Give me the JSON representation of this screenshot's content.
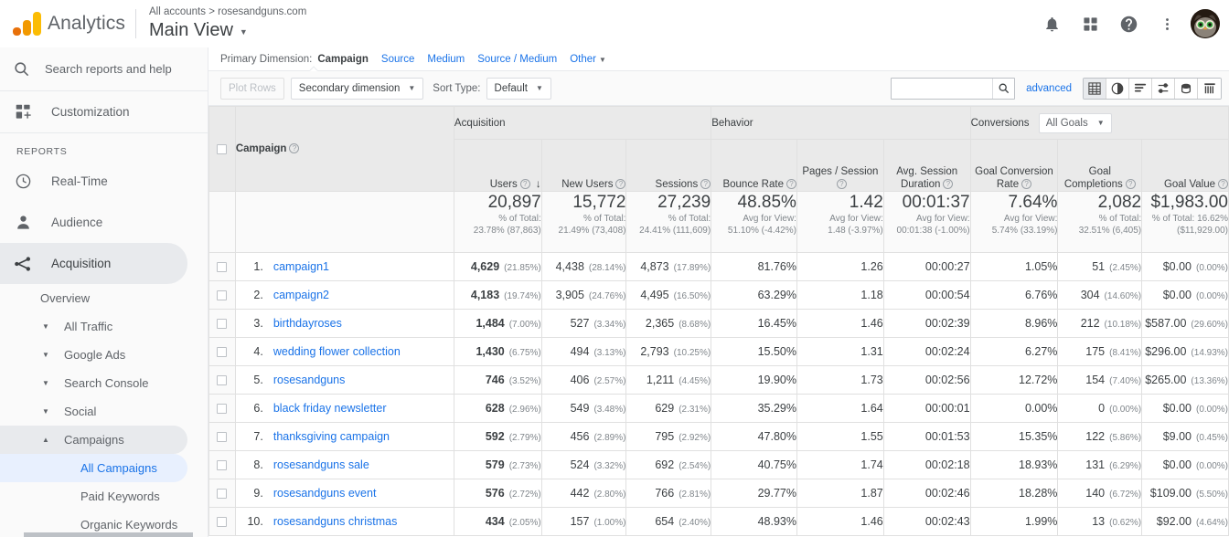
{
  "header": {
    "brand": "Analytics",
    "breadcrumb": "All accounts > rosesandguns.com",
    "view_name": "Main View",
    "view_caret": "▼",
    "icons": {
      "notifications": "bell-icon",
      "apps": "apps-grid-icon",
      "help": "help-circle-icon",
      "more": "more-vertical-icon",
      "account": "avatar"
    }
  },
  "sidebar": {
    "search_placeholder": "Search reports and help",
    "customization": "Customization",
    "reports_label": "REPORTS",
    "items": [
      {
        "label": "Real-Time",
        "icon": "clock-icon"
      },
      {
        "label": "Audience",
        "icon": "person-icon"
      },
      {
        "label": "Acquisition",
        "icon": "acquisition-icon",
        "active": true
      }
    ],
    "acquisition_sub": [
      {
        "label": "Overview",
        "caret": ""
      },
      {
        "label": "All Traffic",
        "caret": "▼"
      },
      {
        "label": "Google Ads",
        "caret": "▼"
      },
      {
        "label": "Search Console",
        "caret": "▼"
      },
      {
        "label": "Social",
        "caret": "▼"
      },
      {
        "label": "Campaigns",
        "caret": "▲",
        "open": true
      }
    ],
    "campaigns_sub": [
      {
        "label": "All Campaigns",
        "selected": true
      },
      {
        "label": "Paid Keywords"
      },
      {
        "label": "Organic Keywords"
      }
    ]
  },
  "dimension_row": {
    "label": "Primary Dimension:",
    "selected": "Campaign",
    "links": [
      "Source",
      "Medium",
      "Source / Medium"
    ],
    "other": "Other",
    "other_caret": "▼"
  },
  "toolbar": {
    "plot_rows": "Plot Rows",
    "secondary_dimension": "Secondary dimension",
    "sort_type_label": "Sort Type:",
    "sort_type_value": "Default",
    "dropdown_caret": "▼",
    "search_value": "",
    "search_placeholder": "",
    "advanced": "advanced",
    "view_icons": [
      {
        "name": "table-view-icon",
        "active": true
      },
      {
        "name": "pie-chart-view-icon",
        "active": false
      },
      {
        "name": "performance-view-icon",
        "active": false
      },
      {
        "name": "comparison-view-icon",
        "active": false
      },
      {
        "name": "pivot-view-icon",
        "active": false
      },
      {
        "name": "bar-view-icon",
        "active": false
      }
    ]
  },
  "table": {
    "groups": [
      {
        "label": "Acquisition",
        "span": 3
      },
      {
        "label": "Behavior",
        "span": 3
      },
      {
        "label": "Conversions",
        "span": 3,
        "goal_select": "All Goals",
        "goal_caret": "▼"
      }
    ],
    "dimension_header": "Campaign",
    "columns": [
      {
        "label": "Users",
        "sorted": true,
        "sort_icon": "↓"
      },
      {
        "label": "New Users"
      },
      {
        "label": "Sessions"
      },
      {
        "label": "Bounce Rate"
      },
      {
        "label": "Pages / Session"
      },
      {
        "label": "Avg. Session Duration"
      },
      {
        "label": "Goal Conversion Rate"
      },
      {
        "label": "Goal Completions"
      },
      {
        "label": "Goal Value"
      }
    ],
    "totals": [
      {
        "value": "20,897",
        "sub1": "% of Total:",
        "sub2": "23.78% (87,863)"
      },
      {
        "value": "15,772",
        "sub1": "% of Total:",
        "sub2": "21.49% (73,408)"
      },
      {
        "value": "27,239",
        "sub1": "% of Total:",
        "sub2": "24.41% (111,609)"
      },
      {
        "value": "48.85%",
        "sub1": "Avg for View:",
        "sub2": "51.10% (-4.42%)"
      },
      {
        "value": "1.42",
        "sub1": "Avg for View:",
        "sub2": "1.48 (-3.97%)"
      },
      {
        "value": "00:01:37",
        "sub1": "Avg for View:",
        "sub2": "00:01:38 (-1.00%)"
      },
      {
        "value": "7.64%",
        "sub1": "Avg for View:",
        "sub2": "5.74% (33.19%)"
      },
      {
        "value": "2,082",
        "sub1": "% of Total:",
        "sub2": "32.51% (6,405)"
      },
      {
        "value": "$1,983.00",
        "sub1": "% of Total: 16.62%",
        "sub2": "($11,929.00)"
      }
    ],
    "rows": [
      {
        "n": "1.",
        "name": "campaign1",
        "users": "4,629",
        "users_pct": "(21.85%)",
        "new_users": "4,438",
        "new_users_pct": "(28.14%)",
        "sessions": "4,873",
        "sessions_pct": "(17.89%)",
        "bounce": "81.76%",
        "pages": "1.26",
        "duration": "00:00:27",
        "gcr": "1.05%",
        "gc": "51",
        "gc_pct": "(2.45%)",
        "gv": "$0.00",
        "gv_pct": "(0.00%)"
      },
      {
        "n": "2.",
        "name": "campaign2",
        "users": "4,183",
        "users_pct": "(19.74%)",
        "new_users": "3,905",
        "new_users_pct": "(24.76%)",
        "sessions": "4,495",
        "sessions_pct": "(16.50%)",
        "bounce": "63.29%",
        "pages": "1.18",
        "duration": "00:00:54",
        "gcr": "6.76%",
        "gc": "304",
        "gc_pct": "(14.60%)",
        "gv": "$0.00",
        "gv_pct": "(0.00%)"
      },
      {
        "n": "3.",
        "name": "birthdayroses",
        "users": "1,484",
        "users_pct": "(7.00%)",
        "new_users": "527",
        "new_users_pct": "(3.34%)",
        "sessions": "2,365",
        "sessions_pct": "(8.68%)",
        "bounce": "16.45%",
        "pages": "1.46",
        "duration": "00:02:39",
        "gcr": "8.96%",
        "gc": "212",
        "gc_pct": "(10.18%)",
        "gv": "$587.00",
        "gv_pct": "(29.60%)"
      },
      {
        "n": "4.",
        "name": "wedding flower collection",
        "users": "1,430",
        "users_pct": "(6.75%)",
        "new_users": "494",
        "new_users_pct": "(3.13%)",
        "sessions": "2,793",
        "sessions_pct": "(10.25%)",
        "bounce": "15.50%",
        "pages": "1.31",
        "duration": "00:02:24",
        "gcr": "6.27%",
        "gc": "175",
        "gc_pct": "(8.41%)",
        "gv": "$296.00",
        "gv_pct": "(14.93%)"
      },
      {
        "n": "5.",
        "name": "rosesandguns",
        "users": "746",
        "users_pct": "(3.52%)",
        "new_users": "406",
        "new_users_pct": "(2.57%)",
        "sessions": "1,211",
        "sessions_pct": "(4.45%)",
        "bounce": "19.90%",
        "pages": "1.73",
        "duration": "00:02:56",
        "gcr": "12.72%",
        "gc": "154",
        "gc_pct": "(7.40%)",
        "gv": "$265.00",
        "gv_pct": "(13.36%)"
      },
      {
        "n": "6.",
        "name": "black friday newsletter",
        "users": "628",
        "users_pct": "(2.96%)",
        "new_users": "549",
        "new_users_pct": "(3.48%)",
        "sessions": "629",
        "sessions_pct": "(2.31%)",
        "bounce": "35.29%",
        "pages": "1.64",
        "duration": "00:00:01",
        "gcr": "0.00%",
        "gc": "0",
        "gc_pct": "(0.00%)",
        "gv": "$0.00",
        "gv_pct": "(0.00%)"
      },
      {
        "n": "7.",
        "name": "thanksgiving campaign",
        "users": "592",
        "users_pct": "(2.79%)",
        "new_users": "456",
        "new_users_pct": "(2.89%)",
        "sessions": "795",
        "sessions_pct": "(2.92%)",
        "bounce": "47.80%",
        "pages": "1.55",
        "duration": "00:01:53",
        "gcr": "15.35%",
        "gc": "122",
        "gc_pct": "(5.86%)",
        "gv": "$9.00",
        "gv_pct": "(0.45%)"
      },
      {
        "n": "8.",
        "name": "rosesandguns sale",
        "users": "579",
        "users_pct": "(2.73%)",
        "new_users": "524",
        "new_users_pct": "(3.32%)",
        "sessions": "692",
        "sessions_pct": "(2.54%)",
        "bounce": "40.75%",
        "pages": "1.74",
        "duration": "00:02:18",
        "gcr": "18.93%",
        "gc": "131",
        "gc_pct": "(6.29%)",
        "gv": "$0.00",
        "gv_pct": "(0.00%)"
      },
      {
        "n": "9.",
        "name": "rosesandguns event",
        "users": "576",
        "users_pct": "(2.72%)",
        "new_users": "442",
        "new_users_pct": "(2.80%)",
        "sessions": "766",
        "sessions_pct": "(2.81%)",
        "bounce": "29.77%",
        "pages": "1.87",
        "duration": "00:02:46",
        "gcr": "18.28%",
        "gc": "140",
        "gc_pct": "(6.72%)",
        "gv": "$109.00",
        "gv_pct": "(5.50%)"
      },
      {
        "n": "10.",
        "name": "rosesandguns christmas",
        "users": "434",
        "users_pct": "(2.05%)",
        "new_users": "157",
        "new_users_pct": "(1.00%)",
        "sessions": "654",
        "sessions_pct": "(2.40%)",
        "bounce": "48.93%",
        "pages": "1.46",
        "duration": "00:02:43",
        "gcr": "1.99%",
        "gc": "13",
        "gc_pct": "(0.62%)",
        "gv": "$92.00",
        "gv_pct": "(4.64%)"
      }
    ]
  },
  "colors": {
    "link": "#1a73e8",
    "selected_bg": "#e8f0fe",
    "header_bg": "#eaeaea",
    "brand_orange": "#F29900"
  }
}
